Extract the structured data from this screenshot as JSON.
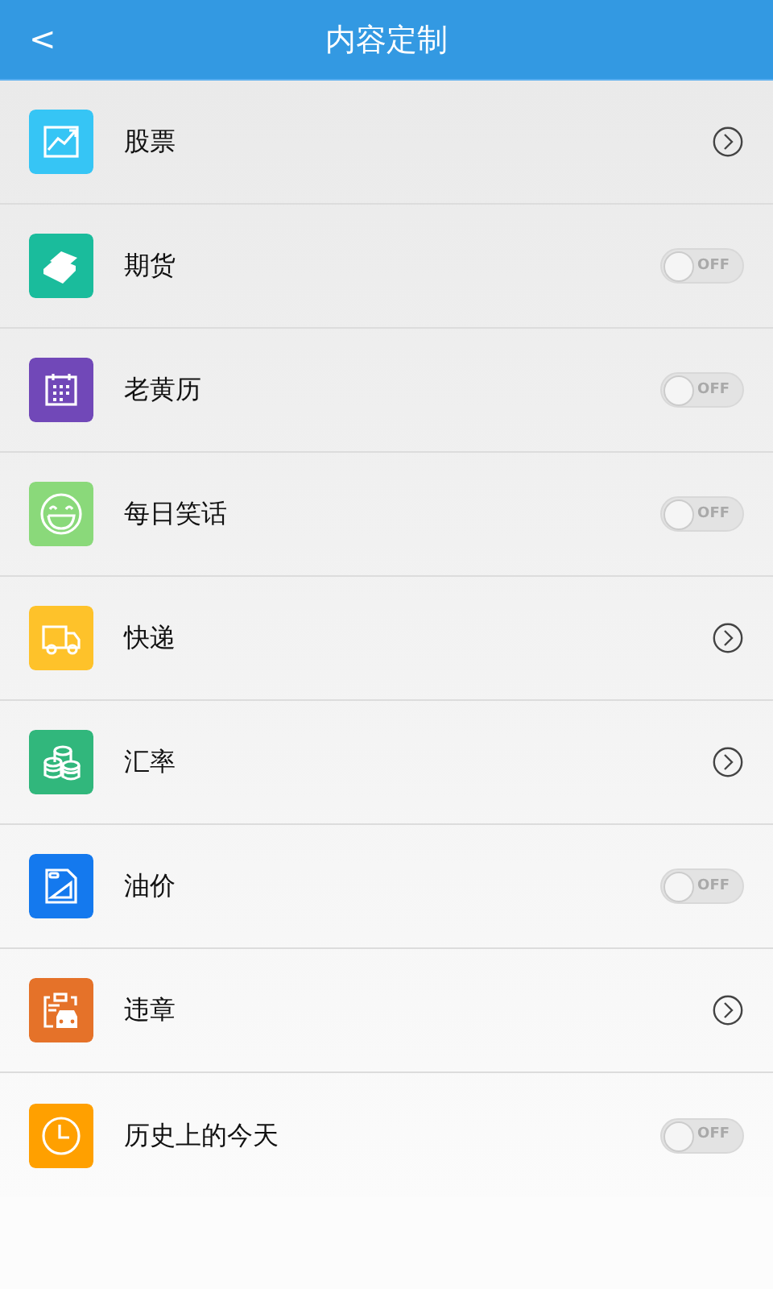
{
  "header": {
    "back_glyph": "<",
    "title": "内容定制"
  },
  "items": [
    {
      "label": "股票",
      "kind": "link",
      "color": "#36c5f5"
    },
    {
      "label": "期货",
      "kind": "toggle",
      "on": false,
      "toggle_text": "OFF",
      "color": "#1abc9c"
    },
    {
      "label": "老黄历",
      "kind": "toggle",
      "on": false,
      "toggle_text": "OFF",
      "color": "#7148b8"
    },
    {
      "label": "每日笑话",
      "kind": "toggle",
      "on": false,
      "toggle_text": "OFF",
      "color": "#8ad97a"
    },
    {
      "label": "快递",
      "kind": "link",
      "color": "#fec22a"
    },
    {
      "label": "汇率",
      "kind": "link",
      "color": "#31b77c"
    },
    {
      "label": "油价",
      "kind": "toggle",
      "on": false,
      "toggle_text": "OFF",
      "color": "#1479ee"
    },
    {
      "label": "违章",
      "kind": "link",
      "color": "#e57229"
    },
    {
      "label": "历史上的今天",
      "kind": "toggle",
      "on": false,
      "toggle_text": "OFF",
      "color": "#ffa000"
    }
  ]
}
